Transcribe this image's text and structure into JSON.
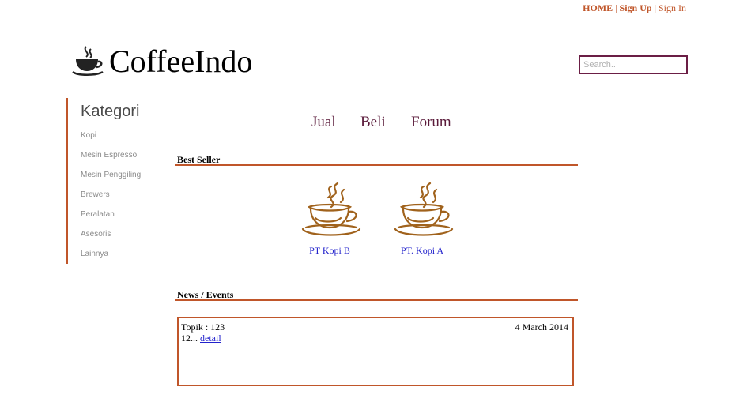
{
  "topnav": {
    "home": "HOME",
    "sep1": " | ",
    "signup": "Sign Up",
    "sep2": " | ",
    "signin": "Sign In"
  },
  "brand": {
    "name": "CoffeeIndo",
    "icon": "coffee-cup-icon"
  },
  "search": {
    "placeholder": "Search.."
  },
  "sidebar": {
    "title": "Kategori",
    "items": [
      "Kopi",
      "Mesin Espresso",
      "Mesin Penggiling",
      "Brewers",
      "Peralatan",
      "Asesoris",
      "Lainnya"
    ]
  },
  "nav": {
    "items": [
      "Jual",
      "Beli",
      "Forum"
    ]
  },
  "best_seller": {
    "title": "Best Seller",
    "products": [
      {
        "name": "PT Kopi B",
        "icon": "coffee-cup-icon"
      },
      {
        "name": "PT. Kopi A",
        "icon": "coffee-cup-icon"
      }
    ]
  },
  "news": {
    "title": "News / Events",
    "topic": "Topik : 123",
    "date": "4 March 2014",
    "excerpt": "12...",
    "link": "detail"
  },
  "colors": {
    "accent": "#c0562a",
    "nav": "#5a1a3a",
    "link": "#2222cc",
    "search_border": "#6b1e45",
    "cup": "#a0621c"
  }
}
